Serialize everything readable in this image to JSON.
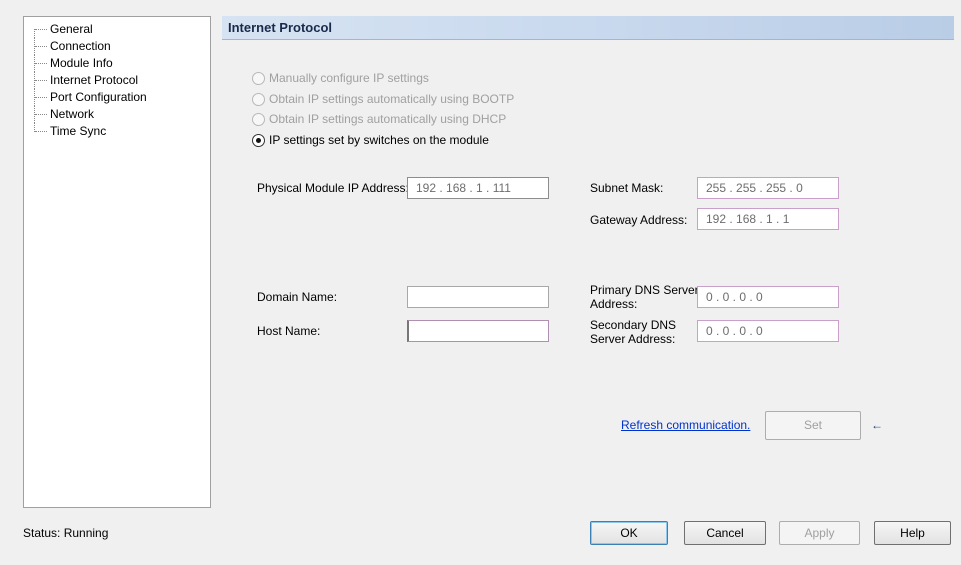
{
  "tree": {
    "items": [
      {
        "label": "General"
      },
      {
        "label": "Connection"
      },
      {
        "label": "Module Info"
      },
      {
        "label": "Internet Protocol"
      },
      {
        "label": "Port Configuration"
      },
      {
        "label": "Network"
      },
      {
        "label": "Time Sync"
      }
    ]
  },
  "header": {
    "title": "Internet Protocol"
  },
  "ip_mode": {
    "options": [
      {
        "label": "Manually configure IP settings",
        "enabled": false,
        "selected": false
      },
      {
        "label": "Obtain IP settings automatically using BOOTP",
        "enabled": false,
        "selected": false
      },
      {
        "label": "Obtain IP settings automatically using DHCP",
        "enabled": false,
        "selected": false
      },
      {
        "label": "IP settings set by switches on the module",
        "enabled": true,
        "selected": true
      }
    ]
  },
  "fields": {
    "ip_label": "Physical Module IP Address:",
    "ip_value": "192  .  168  .  1  .  111",
    "subnet_label": "Subnet Mask:",
    "subnet_value": "255  .  255  .  255  .  0",
    "gateway_label": "Gateway Address:",
    "gateway_value": "192  .  168  .  1  .  1",
    "domain_label": "Domain Name:",
    "domain_value": "",
    "host_label": "Host Name:",
    "host_value": "",
    "primary_dns_label_1": "Primary DNS Server",
    "primary_dns_label_2": "Address:",
    "primary_dns_value": "0  .  0  .  0  .  0",
    "secondary_dns_label_1": "Secondary DNS",
    "secondary_dns_label_2": "Server Address:",
    "secondary_dns_value": "0  .  0  .  0  .  0"
  },
  "actions": {
    "refresh_link": "Refresh communication.",
    "set_button": "Set"
  },
  "footer": {
    "status": "Status:  Running",
    "ok": "OK",
    "cancel": "Cancel",
    "apply": "Apply",
    "help": "Help"
  }
}
